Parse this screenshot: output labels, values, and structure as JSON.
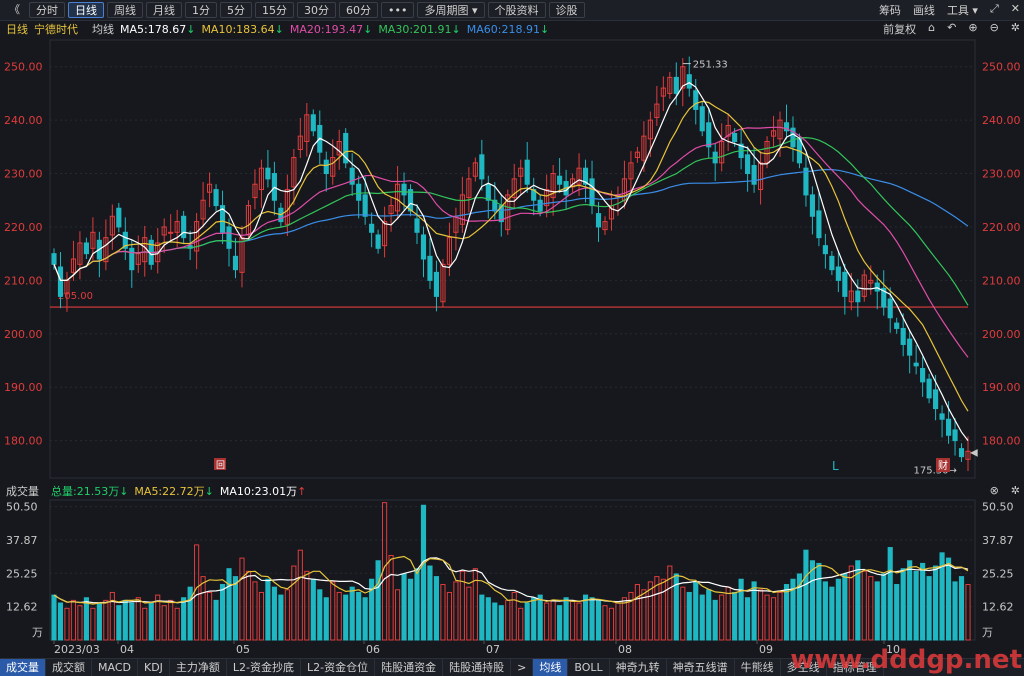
{
  "toolbar": {
    "back": "《",
    "buttons": [
      "分时",
      "日线",
      "周线",
      "月线",
      "1分",
      "5分",
      "15分",
      "30分",
      "60分",
      "•••",
      "多周期图 ▾",
      "个股资料",
      "诊股"
    ],
    "active": "日线",
    "right": [
      "筹码",
      "画线",
      "工具 ▾",
      "⤢",
      "✕"
    ]
  },
  "info": {
    "period": "日线",
    "stock": "宁德时代",
    "ma_label": "均线",
    "ma5": "MA5:178.67",
    "ma10": "MA10:183.64",
    "ma20": "MA20:193.47",
    "ma30": "MA30:201.91",
    "ma60": "MA60:218.91",
    "right": "前复权"
  },
  "vol": {
    "label": "成交量",
    "total": "总量:21.53万",
    "ma5": "MA5:22.72万",
    "ma10": "MA10:23.01万"
  },
  "bottom_tabs": [
    "成交量",
    "成交额",
    "MACD",
    "KDJ",
    "主力净额",
    "L2-资金抄底",
    "L2-资金仓位",
    "陆股通资金",
    "陆股通持股",
    ">",
    "均线",
    "BOLL",
    "神奇九转",
    "神奇五线谱",
    "牛熊线",
    "多空线",
    "指标管理"
  ],
  "watermark": "www.dddgp.net",
  "colors": {
    "up": "#e03c3c",
    "down": "#1fb7c2",
    "ma5": "#ffffff",
    "ma10": "#e8c43a",
    "ma20": "#e04da8",
    "ma30": "#34c35a",
    "ma60": "#3a8ee8"
  },
  "chart_data": {
    "type": "candlestick",
    "y_ticks": [
      "250.00",
      "240.00",
      "230.00",
      "220.00",
      "210.00",
      "200.00",
      "190.00",
      "180.00"
    ],
    "ylim": [
      173,
      255
    ],
    "vol_ticks": [
      "50.50",
      "37.87",
      "25.25",
      "12.62",
      "万"
    ],
    "vol_ylim": [
      0,
      53
    ],
    "x_labels": [
      "2023/03",
      "04",
      "05",
      "06",
      "07",
      "08",
      "09",
      "10"
    ],
    "annotations": {
      "high": "251.33",
      "low": "175.30",
      "level": "205.00",
      "markers": [
        "回",
        "L",
        "财"
      ]
    },
    "closes": [
      213,
      207,
      210,
      214,
      217,
      215,
      219,
      214,
      218,
      222,
      220,
      216,
      212,
      215,
      218,
      213,
      217,
      220,
      219,
      221,
      218,
      216,
      221,
      225,
      228,
      224,
      219,
      216,
      212,
      218,
      224,
      228,
      231,
      229,
      225,
      221,
      227,
      233,
      237,
      241,
      238,
      234,
      230,
      233,
      236,
      232,
      228,
      225,
      222,
      219,
      216,
      221,
      224,
      228,
      226,
      223,
      219,
      214,
      210,
      207,
      213,
      218,
      222,
      226,
      229,
      232,
      229,
      225,
      223,
      221,
      226,
      229,
      231,
      228,
      225,
      223,
      227,
      230,
      228,
      226,
      229,
      231,
      228,
      224,
      220,
      221,
      224,
      226,
      229,
      232,
      234,
      237,
      240,
      243,
      246,
      248,
      245,
      250,
      246,
      242,
      238,
      235,
      232,
      236,
      239,
      236,
      233,
      230,
      228,
      232,
      236,
      238,
      240,
      238,
      235,
      232,
      226,
      222,
      218,
      215,
      212,
      210,
      207,
      208,
      206,
      211,
      210,
      208,
      205,
      203,
      201,
      198,
      196,
      194,
      191,
      188,
      186,
      184,
      181,
      180,
      177,
      178
    ],
    "volumes": [
      17,
      14,
      12,
      15,
      13,
      16,
      12,
      14,
      15,
      18,
      13,
      15,
      14,
      16,
      12,
      14,
      17,
      13,
      15,
      12,
      16,
      20,
      36,
      24,
      18,
      15,
      21,
      27,
      24,
      31,
      26,
      22,
      18,
      23,
      20,
      17,
      19,
      28,
      34,
      26,
      23,
      19,
      16,
      22,
      18,
      17,
      20,
      18,
      16,
      23,
      30,
      52,
      32,
      19,
      25,
      23,
      27,
      51,
      28,
      24,
      21,
      18,
      22,
      26,
      20,
      27,
      17,
      16,
      14,
      13,
      15,
      18,
      12,
      14,
      16,
      17,
      14,
      15,
      13,
      16,
      15,
      14,
      17,
      16,
      15,
      13,
      12,
      14,
      16,
      18,
      21,
      19,
      22,
      24,
      23,
      28,
      25,
      20,
      18,
      22,
      17,
      19,
      15,
      17,
      20,
      18,
      23,
      16,
      22,
      19,
      17,
      16,
      18,
      21,
      23,
      25,
      34,
      30,
      29,
      22,
      20,
      23,
      25,
      28,
      30,
      26,
      24,
      22,
      25,
      35,
      21,
      27,
      30,
      26,
      29,
      24,
      28,
      33,
      31,
      22,
      24,
      21
    ]
  }
}
